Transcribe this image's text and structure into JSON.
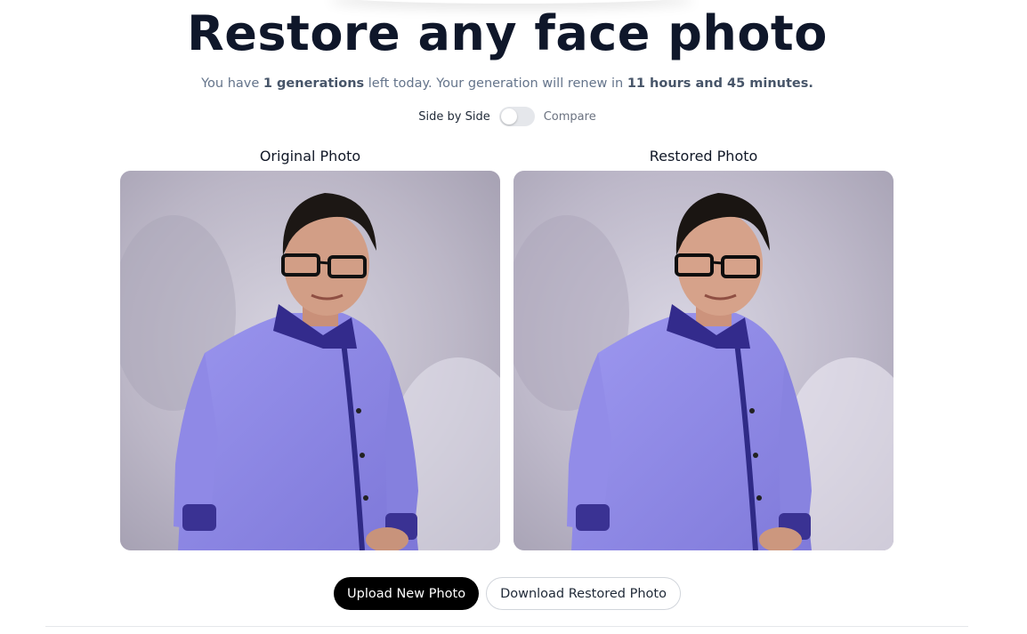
{
  "title": "Restore any face photo",
  "subtitle": {
    "prefix": "You have ",
    "count": "1 generations",
    "middle": " left today. Your generation will renew in ",
    "time": "11 hours and 45 minutes."
  },
  "toggle": {
    "left_label": "Side by Side",
    "right_label": "Compare",
    "state": "off"
  },
  "photos": {
    "original_label": "Original Photo",
    "restored_label": "Restored Photo"
  },
  "buttons": {
    "upload": "Upload New Photo",
    "download": "Download Restored Photo"
  },
  "colors": {
    "title": "#0f172a",
    "primary_button": "#000000",
    "shirt": "#8b86e6",
    "collar": "#312a8a"
  }
}
